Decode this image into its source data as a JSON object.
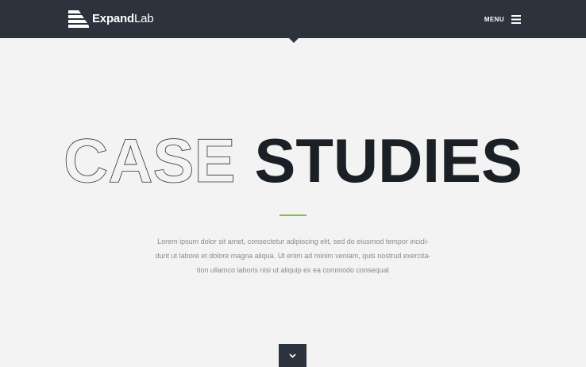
{
  "header": {
    "logo": {
      "bold": "Expand",
      "light": "Lab",
      "icon": "layered-stripes-logo-icon"
    },
    "menu_label": "MENU",
    "menu_icon": "hamburger-icon",
    "background": "#2d333d"
  },
  "hero": {
    "title_outline": "CASE",
    "title_solid": "STUDIES",
    "accent_color": "#7ac143",
    "intro_lines": [
      "Lorem ipsum dolor sit amet, consectetur adipiscing elit, sed do eiusmod tempor incidi-",
      "dunt ut labore et dolore magna aliqua. Ut enim ad minim veniam, quis nostrud exercita-",
      "tion ullamco laboris nisi ut aliquip ex ea commodo consequat"
    ]
  },
  "scroll_button": {
    "icon": "chevron-down-icon"
  }
}
